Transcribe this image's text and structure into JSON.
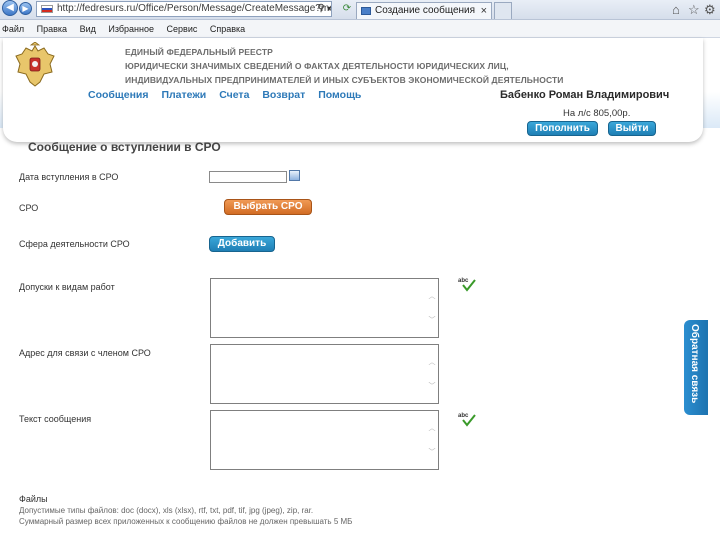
{
  "browser": {
    "url": "http://fedresurs.ru/Office/Person/Message/CreateMessage?messageType=",
    "tab_title": "Создание сообщения",
    "tab_close": "×",
    "menu": [
      "Файл",
      "Правка",
      "Вид",
      "Избранное",
      "Сервис",
      "Справка"
    ]
  },
  "header": {
    "registry_title": [
      "ЕДИНЫЙ ФЕДЕРАЛЬНЫЙ РЕЕСТР",
      "ЮРИДИЧЕСКИ ЗНАЧИМЫХ СВЕДЕНИЙ О ФАКТАХ ДЕЯТЕЛЬНОСТИ ЮРИДИЧЕСКИХ ЛИЦ,",
      "ИНДИВИДУАЛЬНЫХ ПРЕДПРИНИМАТЕЛЕЙ И ИНЫХ СУБЪЕКТОВ ЭКОНОМИЧЕСКОЙ ДЕЯТЕЛЬНОСТИ"
    ],
    "nav": [
      "Сообщения",
      "Платежи",
      "Счета",
      "Возврат",
      "Помощь"
    ],
    "user_name": "Бабенко Роман Владимирович",
    "balance": "На л/с 805,00р.",
    "topup_button": "Пополнить",
    "logout_button": "Выйти"
  },
  "form": {
    "title": "Сообщение о вступлении в СРО",
    "date_label": "Дата вступления в СРО",
    "date_value": "",
    "sro_label": "СРО",
    "choose_sro_button": "Выбрать СРО",
    "sphere_label": "Сфера деятельности СРО",
    "add_button": "Добавить",
    "permits_label": "Допуски к видам работ",
    "address_label": "Адрес для связи с членом СРО",
    "message_label": "Текст сообщения",
    "spell_label": "abc"
  },
  "files": {
    "title": "Файлы",
    "allowed_types": "Допустимые типы файлов: doc (docx), xls (xlsx), rtf, txt, pdf, tif, jpg (jpeg), zip, rar.",
    "size_note": "Суммарный размер всех приложенных к сообщению файлов не должен превышать 5 МБ"
  },
  "feedback_tab": "Обратная связь",
  "colors": {
    "accent_blue": "#2d79b8",
    "button_blue": "#1f7fb5",
    "button_orange": "#d26c24"
  }
}
